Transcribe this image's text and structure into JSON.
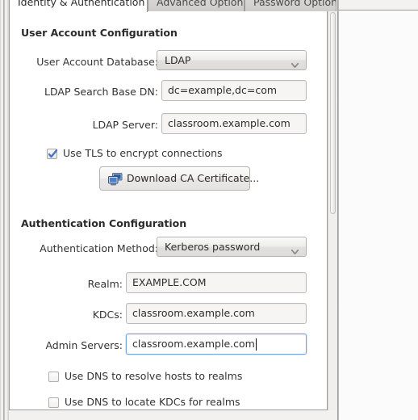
{
  "window": {
    "tabs": [
      {
        "label": "Identity & Authentication",
        "active": true
      },
      {
        "label": "Advanced Options",
        "active": false
      },
      {
        "label": "Password Options",
        "active": false
      }
    ]
  },
  "user_account_section": {
    "heading": "User Account Configuration",
    "database": {
      "label": "User Account Database:",
      "value": "LDAP",
      "arrow_icon": "chevron-down-icon"
    },
    "search_base_dn": {
      "label": "LDAP Search Base DN:",
      "value": "dc=example,dc=com"
    },
    "ldap_server": {
      "label": "LDAP Server:",
      "value": "classroom.example.com"
    },
    "use_tls": {
      "label": "Use TLS to encrypt connections",
      "checked": true
    },
    "download_ca_button": {
      "label": "Download CA Certificate...",
      "icon": "computer-network-icon"
    }
  },
  "authentication_section": {
    "heading": "Authentication Configuration",
    "method": {
      "label": "Authentication Method:",
      "value": "Kerberos password",
      "arrow_icon": "chevron-down-icon"
    },
    "realm": {
      "label": "Realm:",
      "value": "EXAMPLE.COM"
    },
    "kdcs": {
      "label": "KDCs:",
      "value": "classroom.example.com"
    },
    "admin_servers": {
      "label": "Admin Servers:",
      "value": "classroom.example.com",
      "focused": true
    },
    "dns_resolve_hosts": {
      "label": "Use DNS to resolve hosts to realms",
      "checked": false
    },
    "dns_locate_kdcs": {
      "label": "Use DNS to locate KDCs for realms",
      "checked": false
    }
  },
  "colors": {
    "focus_border": "#7da7d9",
    "check_blue": "#4a76c4",
    "panel_bg": "#ffffff",
    "chrome_bg": "#f0efee"
  }
}
